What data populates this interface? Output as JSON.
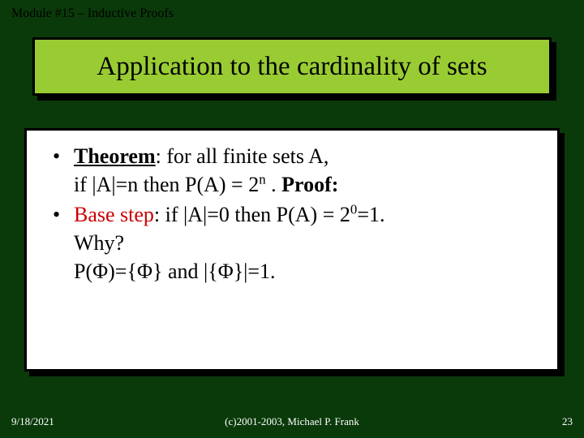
{
  "module_header": "Module #15 – Inductive Proofs",
  "title": "Application to the cardinality of sets",
  "bullets": [
    {
      "label": "Theorem",
      "lead": ": for all finite sets A,",
      "line2_a": "if |A|=n  then P(A) = 2",
      "line2_sup": "n",
      "line2_b": "  . ",
      "proof": "Proof:"
    },
    {
      "base_label": "Base step",
      "base_rest_a": ":  if |A|=0  then P(A) = 2",
      "base_sup": "0",
      "base_rest_b": "=1.",
      "why": "Why?",
      "pline_a": "P(",
      "phi1": "Φ",
      "pline_b": ")={",
      "phi2": "Φ",
      "pline_c": "} and |{",
      "phi3": "Φ",
      "pline_d": "}|=1."
    }
  ],
  "footer": {
    "date": "9/18/2021",
    "copy": "(c)2001-2003, Michael P. Frank",
    "page": "23"
  }
}
